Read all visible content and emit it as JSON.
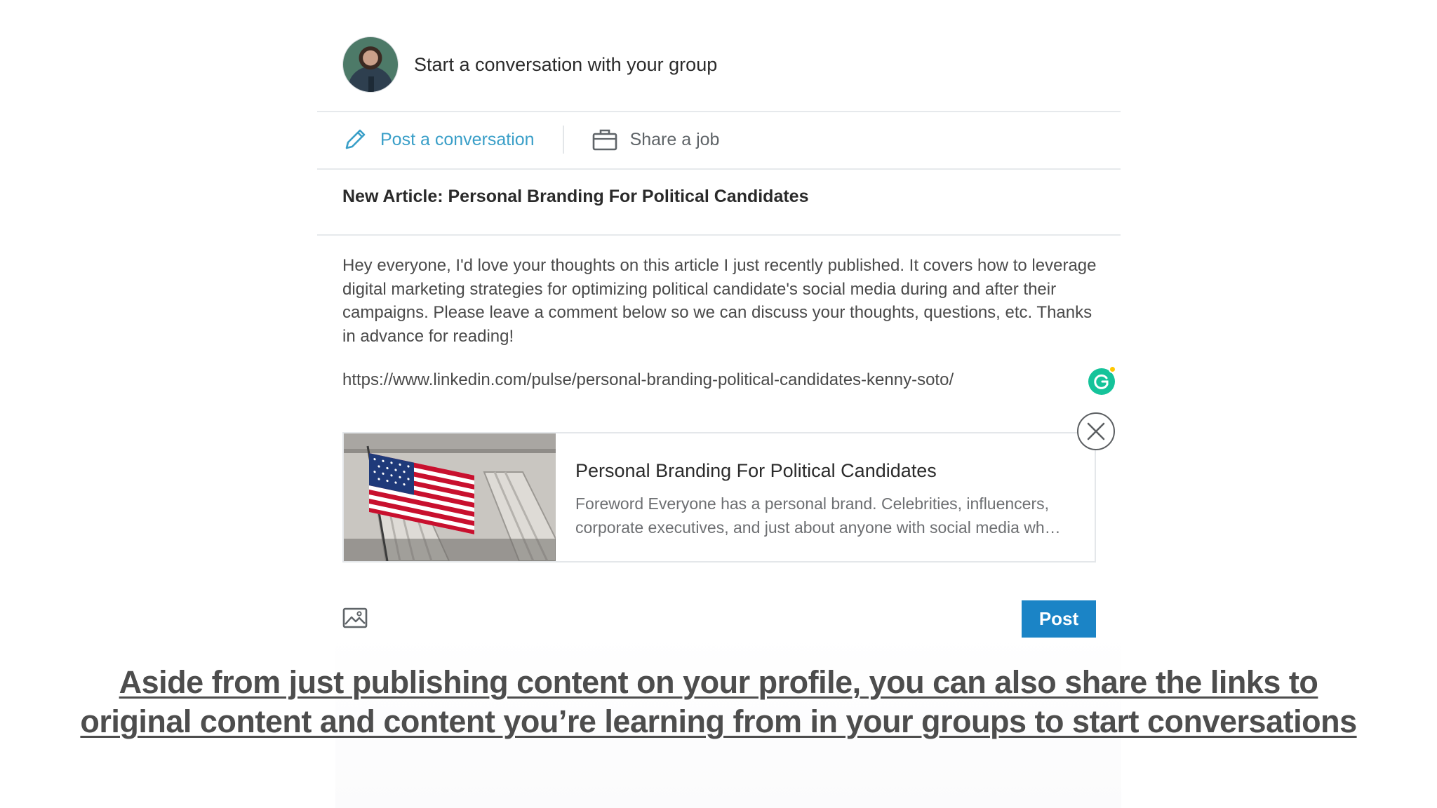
{
  "composer": {
    "prompt": "Start a conversation with your group",
    "tabs": [
      {
        "label": "Post a conversation",
        "icon": "pencil-icon",
        "active": true
      },
      {
        "label": "Share a job",
        "icon": "briefcase-icon",
        "active": false
      }
    ],
    "post_title": "New Article: Personal Branding For Political Candidates",
    "body": "Hey everyone, I'd love your thoughts on this article I just recently published. It covers how to leverage digital marketing strategies for optimizing political candidate's social media during and after their campaigns. Please leave a comment below so we can discuss your thoughts, questions, etc. Thanks in advance for reading!",
    "url": "https://www.linkedin.com/pulse/personal-branding-political-candidates-kenny-soto/",
    "link_preview": {
      "title": "Personal Branding For Political Candidates",
      "description": "Foreword Everyone has a personal brand. Celebrities, influencers, corporate executives, and just about anyone with social media wh…"
    },
    "post_button": "Post"
  },
  "colors": {
    "accent": "#3a9fc8",
    "post_button": "#1b84c6",
    "grammarly": "#15c39a"
  },
  "caption": "Aside from just publishing content on your profile, you can also share the links to original content and content you’re learning from in your groups to start conversations"
}
